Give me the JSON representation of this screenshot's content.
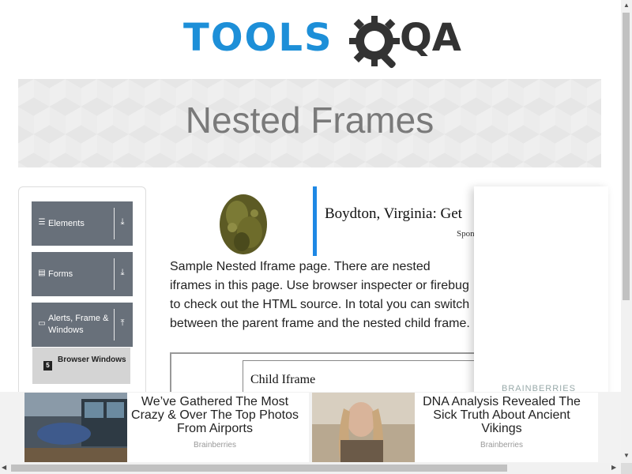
{
  "header": {
    "logo_text": "TOOLS",
    "logo_suffix": "QA"
  },
  "banner": {
    "title": "Nested Frames"
  },
  "sidebar": {
    "groups": [
      {
        "label": "Elements",
        "icon": "list-icon",
        "expanded": false
      },
      {
        "label": "Forms",
        "icon": "form-icon",
        "expanded": false
      },
      {
        "label": "Alerts, Frame & Windows",
        "icon": "window-icon",
        "expanded": true
      }
    ],
    "items": [
      {
        "label": "Browser Windows",
        "icon": "html5-icon"
      }
    ]
  },
  "ad_top": {
    "headline": "Boydton, Virginia: Get",
    "sponsor": "Spon"
  },
  "content": {
    "description": "Sample Nested Iframe page. There are nested iframes in this page. Use browser inspecter or firebug to check out the HTML source. In total you can switch between the parent frame and the nested child frame.",
    "child_iframe_text": "Child Iframe"
  },
  "ad_right": {
    "label": "BRAINBERRIES"
  },
  "bottom_ads": [
    {
      "title": "We’ve Gathered The Most Crazy & Over The Top Photos From Airports",
      "brand": "Brainberries"
    },
    {
      "title": "DNA Analysis Revealed The Sick Truth About Ancient Vikings",
      "brand": "Brainberries"
    }
  ],
  "colors": {
    "brand_blue": "#1d8fd8",
    "sidebar_group": "#68707a",
    "ad_accent": "#1e88e5"
  }
}
